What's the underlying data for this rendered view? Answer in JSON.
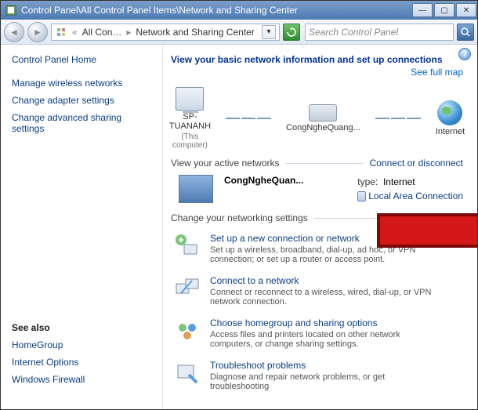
{
  "titlebar": {
    "path": "Control Panel\\All Control Panel Items\\Network and Sharing Center"
  },
  "nav": {
    "crumb1": "All Con…",
    "crumb2": "Network and Sharing Center",
    "search_placeholder": "Search Control Panel"
  },
  "sidebar": {
    "home": "Control Panel Home",
    "links": {
      "wireless": "Manage wireless networks",
      "adapter": "Change adapter settings",
      "advanced": "Change advanced sharing settings"
    },
    "see_also_heading": "See also",
    "see_also": {
      "homegroup": "HomeGroup",
      "ieoptions": "Internet Options",
      "firewall": "Windows Firewall"
    }
  },
  "main": {
    "heading": "View your basic network information and set up connections",
    "full_map": "See full map",
    "map": {
      "node1": "SP-TUANANH",
      "node1_sub": "(This computer)",
      "node2": "CongNgheQuang...",
      "node3": "Internet"
    },
    "active_label": "View your active networks",
    "connect_disconnect": "Connect or disconnect",
    "active": {
      "name": "CongNgheQuan...",
      "type_partial": "type:",
      "access_value": "Internet",
      "conn_link": "Local Area Connection"
    },
    "settings_label": "Change your networking settings",
    "tasks": {
      "t1_title": "Set up a new connection or network",
      "t1_desc": "Set up a wireless, broadband, dial-up, ad hoc, or VPN connection; or set up a router or access point.",
      "t2_title": "Connect to a network",
      "t2_desc": "Connect or reconnect to a wireless, wired, dial-up, or VPN network connection.",
      "t3_title": "Choose homegroup and sharing options",
      "t3_desc": "Access files and printers located on other network computers, or change sharing settings.",
      "t4_title": "Troubleshoot problems",
      "t4_desc": "Diagnose and repair network problems, or get troubleshooting"
    }
  }
}
